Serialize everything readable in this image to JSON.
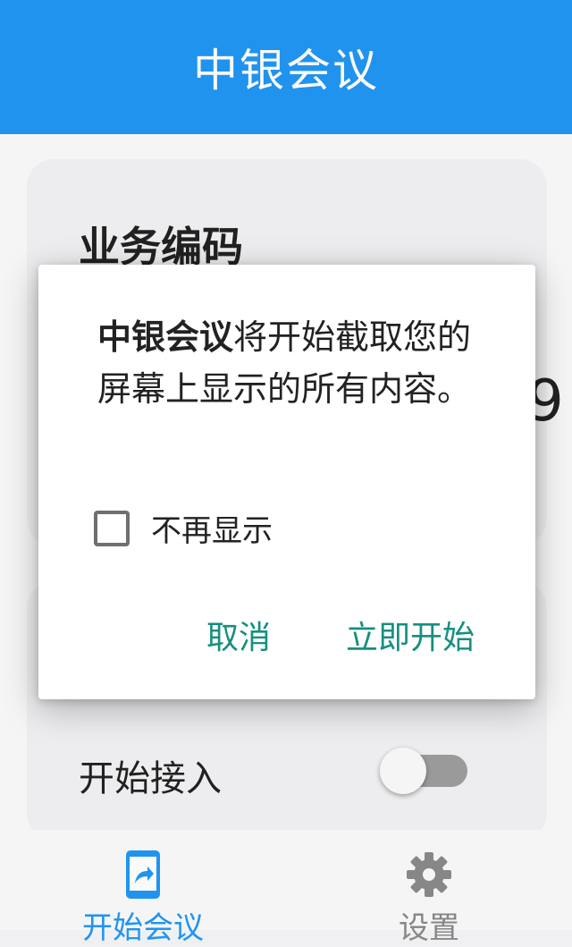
{
  "app_bar": {
    "title": "中银会议"
  },
  "card": {
    "title": "业务编码",
    "code_fragment": "9"
  },
  "access": {
    "label": "开始接入",
    "enabled": false
  },
  "dialog": {
    "app_name": "中银会议",
    "message": "将开始截取您的屏幕上显示的所有内容。",
    "checkbox_label": "不再显示",
    "checkbox_checked": false,
    "cancel_label": "取消",
    "confirm_label": "立即开始"
  },
  "bottom_nav": {
    "items": [
      {
        "label": "开始会议",
        "icon": "screen-share-phone-icon",
        "active": true
      },
      {
        "label": "设置",
        "icon": "gear-icon",
        "active": false
      }
    ]
  },
  "colors": {
    "primary": "#2196f3",
    "dialog_button": "#168f80"
  }
}
